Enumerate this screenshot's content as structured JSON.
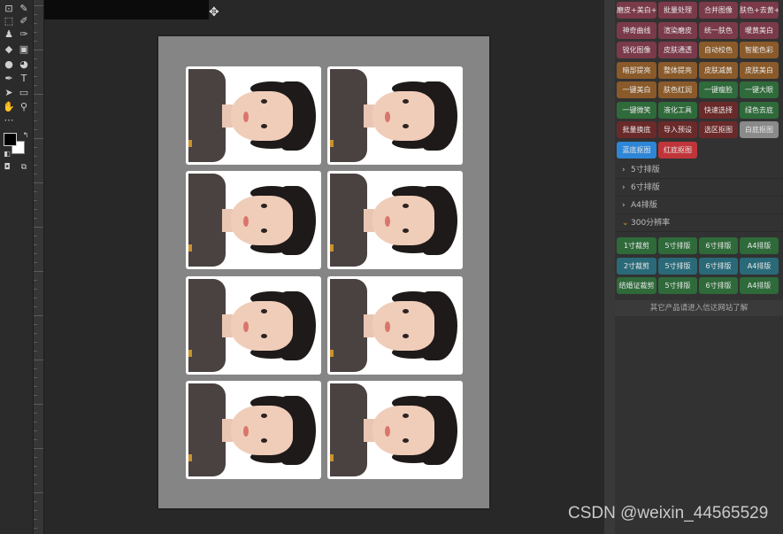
{
  "toolbar": {
    "tools": [
      "crop-icon",
      "eyedropper-icon",
      "marquee-icon",
      "brush-icon",
      "stamp-icon",
      "history-brush-icon",
      "eraser-icon",
      "gradient-icon",
      "blur-icon",
      "dodge-icon",
      "pen-icon",
      "type-icon",
      "path-select-icon",
      "shape-icon",
      "hand-icon",
      "zoom-icon"
    ]
  },
  "canvas": {
    "cards": [
      {
        "label": "photo-1"
      },
      {
        "label": "photo-2"
      },
      {
        "label": "photo-3"
      },
      {
        "label": "photo-4"
      },
      {
        "label": "photo-5"
      },
      {
        "label": "photo-6"
      },
      {
        "label": "photo-7"
      },
      {
        "label": "photo-8"
      }
    ]
  },
  "panel": {
    "buttons": [
      {
        "label": "磨皮+美白+白平衡+锐化",
        "color": "#7a3a4a"
      },
      {
        "label": "批量处理",
        "color": "#7a3a4a"
      },
      {
        "label": "合并图像",
        "color": "#7a3a4a"
      },
      {
        "label": "肤色+去黄+锐化+清透",
        "color": "#7a3a4a"
      },
      {
        "label": "神奇曲线",
        "color": "#7a3a4a"
      },
      {
        "label": "渲染磨皮",
        "color": "#7a3a4a"
      },
      {
        "label": "统一肤色",
        "color": "#7a3a4a"
      },
      {
        "label": "暖黄美白",
        "color": "#7a3a4a"
      },
      {
        "label": "锐化图像",
        "color": "#7a3a4a"
      },
      {
        "label": "皮肤通透",
        "color": "#7a3a4a"
      },
      {
        "label": "自动校色",
        "color": "#8a5a2a"
      },
      {
        "label": "智能色彩",
        "color": "#8a5a2a"
      },
      {
        "label": "暗部提亮",
        "color": "#8a5a2a"
      },
      {
        "label": "整体提亮",
        "color": "#8a5a2a"
      },
      {
        "label": "皮肤减黄",
        "color": "#8a5a2a"
      },
      {
        "label": "皮肤美白",
        "color": "#8a5a2a"
      },
      {
        "label": "一键美白",
        "color": "#8a5a2a"
      },
      {
        "label": "肤色红润",
        "color": "#8a5a2a"
      },
      {
        "label": "一键瘦脸",
        "color": "#2f6a3a"
      },
      {
        "label": "一键大眼",
        "color": "#2f6a3a"
      },
      {
        "label": "一键微笑",
        "color": "#2f6a3a"
      },
      {
        "label": "液化工具",
        "color": "#2f6a3a"
      },
      {
        "label": "快速选择",
        "color": "#6a2a2a"
      },
      {
        "label": "绿色去底",
        "color": "#2f6a3a"
      },
      {
        "label": "批量换底",
        "color": "#6a2a2a"
      },
      {
        "label": "导入预设",
        "color": "#6a2a2a"
      },
      {
        "label": "选区抠图",
        "color": "#6a2a2a"
      },
      {
        "label": "白底抠图",
        "color": "#8a8a8a"
      },
      {
        "label": "蓝底抠图",
        "color": "#2e86d6"
      },
      {
        "label": "红底抠图",
        "color": "#c0353a"
      }
    ],
    "sections": [
      {
        "label": "5寸排版",
        "arrow": ">"
      },
      {
        "label": "6寸排版",
        "arrow": ">"
      },
      {
        "label": "A4排版",
        "arrow": ">"
      },
      {
        "label": "300分辨率",
        "arrow": "v"
      }
    ],
    "layout_buttons": [
      {
        "label": "1寸裁剪",
        "color": "#2f6a3a"
      },
      {
        "label": "5寸排版",
        "color": "#2f6a3a"
      },
      {
        "label": "6寸排版",
        "color": "#2f6a3a"
      },
      {
        "label": "A4排版",
        "color": "#2f6a3a"
      },
      {
        "label": "2寸裁剪",
        "color": "#2a6a78"
      },
      {
        "label": "5寸排版",
        "color": "#2a6a78"
      },
      {
        "label": "6寸排版",
        "color": "#2a6a78"
      },
      {
        "label": "A4排版",
        "color": "#2a6a78"
      },
      {
        "label": "结婚证裁剪",
        "color": "#2f6a3a"
      },
      {
        "label": "5寸排版",
        "color": "#2f6a3a"
      },
      {
        "label": "6寸排版",
        "color": "#2f6a3a"
      },
      {
        "label": "A4排版",
        "color": "#2f6a3a"
      }
    ],
    "footer": "其它产品请进入信达网站了解"
  },
  "watermark": "CSDN @weixin_44565529"
}
